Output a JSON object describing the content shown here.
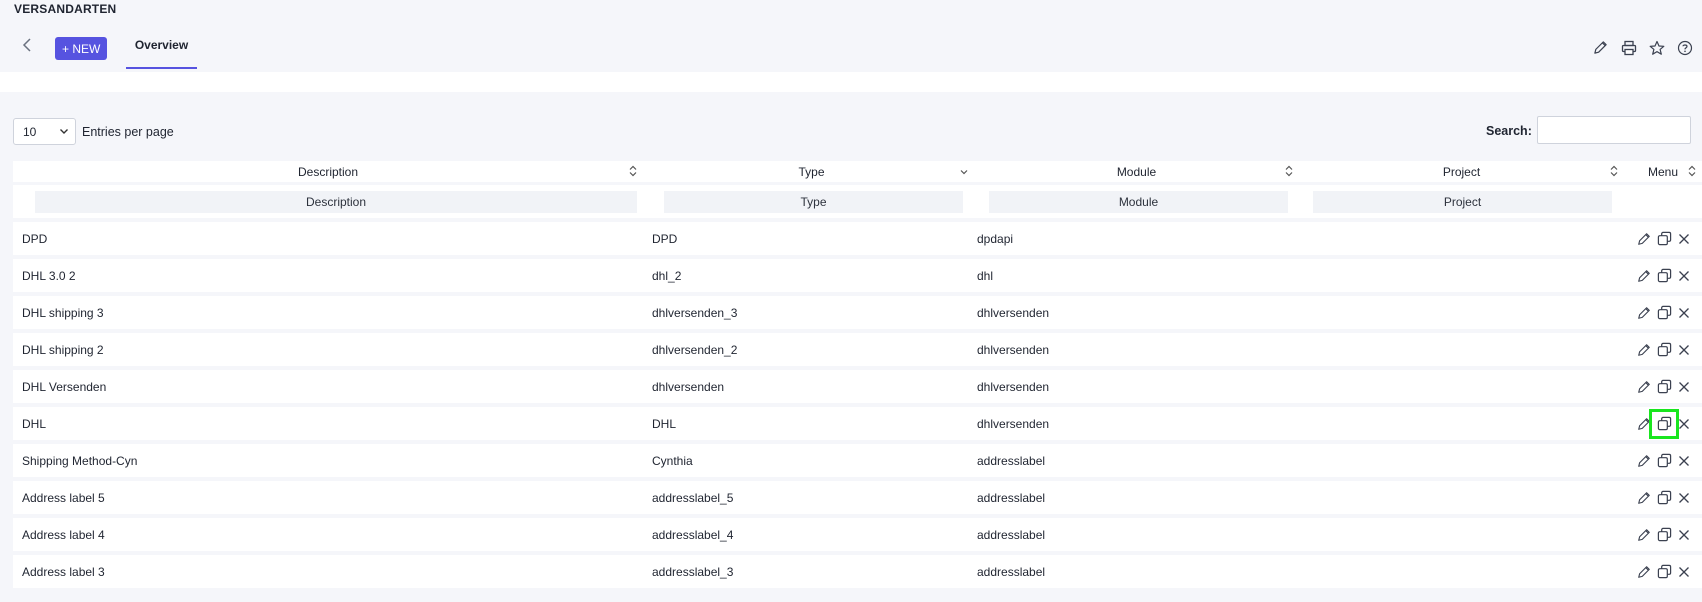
{
  "page": {
    "heading": "VERSANDARTEN"
  },
  "toolbar": {
    "new_label": "+ NEW",
    "tab_label": "Overview",
    "icons": [
      "pencil-icon",
      "printer-icon",
      "star-icon",
      "help-icon"
    ]
  },
  "controls": {
    "entries_value": "10",
    "entries_label": "Entries per page",
    "search_label": "Search:",
    "search_value": ""
  },
  "table": {
    "headers": [
      "Description",
      "Type",
      "Module",
      "Project",
      "Menu"
    ],
    "filters": [
      "Description",
      "Type",
      "Module",
      "Project"
    ],
    "rows": [
      {
        "description": "DPD",
        "type": "DPD",
        "module": "dpdapi",
        "project": ""
      },
      {
        "description": "DHL 3.0 2",
        "type": "dhl_2",
        "module": "dhl",
        "project": ""
      },
      {
        "description": "DHL shipping 3",
        "type": "dhlversenden_3",
        "module": "dhlversenden",
        "project": ""
      },
      {
        "description": "DHL shipping 2",
        "type": "dhlversenden_2",
        "module": "dhlversenden",
        "project": ""
      },
      {
        "description": "DHL Versenden",
        "type": "dhlversenden",
        "module": "dhlversenden",
        "project": ""
      },
      {
        "description": "DHL",
        "type": "DHL",
        "module": "dhlversenden",
        "project": ""
      },
      {
        "description": "Shipping Method-Cyn",
        "type": "Cynthia",
        "module": "addresslabel",
        "project": ""
      },
      {
        "description": "Address label 5",
        "type": "addresslabel_5",
        "module": "addresslabel",
        "project": ""
      },
      {
        "description": "Address label 4",
        "type": "addresslabel_4",
        "module": "addresslabel",
        "project": ""
      },
      {
        "description": "Address label 3",
        "type": "addresslabel_3",
        "module": "addresslabel",
        "project": ""
      }
    ],
    "row_action_icons": [
      "edit-icon",
      "copy-icon",
      "delete-icon"
    ],
    "highlighted": {
      "row": 5,
      "action": "copy-icon",
      "color": "#19e61f"
    }
  },
  "colors": {
    "accent": "#5653e0",
    "background": "#f5f6fa"
  }
}
